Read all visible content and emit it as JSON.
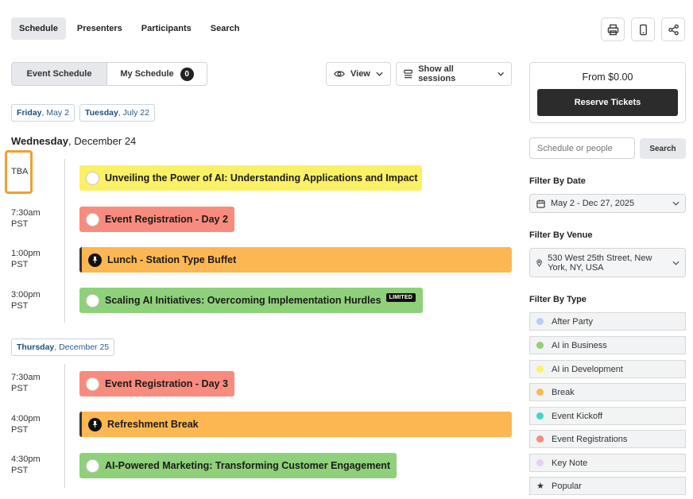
{
  "nav": {
    "tabs": [
      {
        "label": "Schedule",
        "active": true
      },
      {
        "label": "Presenters"
      },
      {
        "label": "Participants"
      },
      {
        "label": "Search"
      }
    ],
    "icons": [
      "printer-icon",
      "mobile-icon",
      "share-icon"
    ]
  },
  "toolbar": {
    "event_schedule": "Event Schedule",
    "my_schedule": "My Schedule",
    "my_schedule_count": "0",
    "view": "View",
    "show_sessions": "Show all sessions"
  },
  "date_chips": [
    {
      "day": "Friday",
      "date": ", May 2"
    },
    {
      "day": "Tuesday",
      "date": ", July 22"
    }
  ],
  "days": [
    {
      "day": "Wednesday",
      "date": ", December 24",
      "events": [
        {
          "time": "TBA",
          "zone": "",
          "title": "Unveiling the Power of AI: Understanding Applications and Impact",
          "color": "#fcf166",
          "icon": "circle"
        },
        {
          "time": "7:30am",
          "zone": "PST",
          "title": "Event Registration - Day 2",
          "color": "#f98b7e",
          "icon": "circle"
        },
        {
          "time": "1:00pm",
          "zone": "PST",
          "title": "Lunch - Station Type Buffet",
          "color": "#fdb752",
          "icon": "pin"
        },
        {
          "time": "3:00pm",
          "zone": "PST",
          "title": "Scaling AI Initiatives: Overcoming Implementation Hurdles",
          "color": "#8fd07a",
          "icon": "circle",
          "badge": "LIMITED"
        }
      ]
    },
    {
      "day": "Thursday",
      "date": ", December 25",
      "events": [
        {
          "time": "7:30am",
          "zone": "PST",
          "title": "Event Registration - Day 3",
          "color": "#f98b7e",
          "icon": "circle"
        },
        {
          "time": "4:00pm",
          "zone": "PST",
          "title": "Refreshment Break",
          "color": "#fdb752",
          "icon": "pin"
        },
        {
          "time": "4:30pm",
          "zone": "PST",
          "title": "AI-Powered Marketing: Transforming Customer Engagement",
          "color": "#8fd07a",
          "icon": "circle"
        }
      ]
    }
  ],
  "sidebar": {
    "price": "From $0.00",
    "reserve": "Reserve Tickets",
    "search_placeholder": "Schedule or people",
    "search_button": "Search",
    "filter_date_label": "Filter By Date",
    "filter_date_value": "May 2 - Dec 27, 2025",
    "filter_venue_label": "Filter By Venue",
    "filter_venue_value": "530 West 25th Street, New York, NY, USA",
    "filter_type_label": "Filter By Type",
    "types": [
      {
        "label": "After Party",
        "color": "#b9cdf6"
      },
      {
        "label": "AI in Business",
        "color": "#8fd07a"
      },
      {
        "label": "AI in Development",
        "color": "#fcf166"
      },
      {
        "label": "Break",
        "color": "#fdb752"
      },
      {
        "label": "Event Kickoff",
        "color": "#3fd6c6"
      },
      {
        "label": "Event Registrations",
        "color": "#f98b7e"
      },
      {
        "label": "Key Note",
        "color": "#e8cff7"
      },
      {
        "label": "Popular",
        "icon": "star-icon"
      }
    ]
  }
}
